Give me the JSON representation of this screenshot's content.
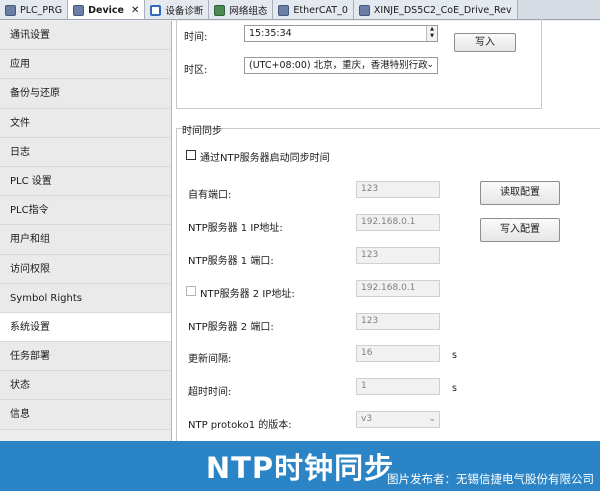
{
  "tabs": [
    {
      "label": "PLC_PRG",
      "icon": "document-icon"
    },
    {
      "label": "Device",
      "icon": "device-icon",
      "closable": true
    },
    {
      "label": "设备诊断",
      "icon": "search-icon"
    },
    {
      "label": "网络组态",
      "icon": "network-icon"
    },
    {
      "label": "EtherCAT_0",
      "icon": "document-icon"
    },
    {
      "label": "XINJE_DS5C2_CoE_Drive_Rev",
      "icon": "document-icon"
    }
  ],
  "tab_close": "✕",
  "sidebar": {
    "items": [
      {
        "label": "通讯设置"
      },
      {
        "label": "应用"
      },
      {
        "label": "备份与还原"
      },
      {
        "label": "文件"
      },
      {
        "label": "日志"
      },
      {
        "label": "PLC 设置"
      },
      {
        "label": "PLC指令"
      },
      {
        "label": "用户和组"
      },
      {
        "label": "访问权限"
      },
      {
        "label": "Symbol Rights"
      },
      {
        "label": "系统设置",
        "selected": true
      },
      {
        "label": "任务部署"
      },
      {
        "label": "状态"
      },
      {
        "label": "信息"
      }
    ]
  },
  "time_settings": {
    "time_label": "时间:",
    "time_value": "15:35:34",
    "timezone_label": "时区:",
    "timezone_value": "(UTC+08:00) 北京，重庆，香港特别行政",
    "write_button": "写入"
  },
  "time_sync": {
    "group_title": "时间同步",
    "enable_ntp_label": "通过NTP服务器启动同步时间",
    "own_port_label": "自有端口:",
    "own_port_value": "123",
    "ntp1_ip_label": "NTP服务器 1 IP地址:",
    "ntp1_ip_value": "192.168.0.1",
    "ntp1_port_label": "NTP服务器 1 端口:",
    "ntp1_port_value": "123",
    "ntp2_ip_label": "NTP服务器 2 IP地址:",
    "ntp2_ip_value": "192.168.0.1",
    "ntp2_port_label": "NTP服务器 2 端口:",
    "ntp2_port_value": "123",
    "update_interval_label": "更新间隔:",
    "update_interval_value": "16",
    "update_interval_unit": "s",
    "timeout_label": "超时时间:",
    "timeout_value": "1",
    "timeout_unit": "s",
    "protocol_label": "NTP protoko1 的版本:",
    "protocol_value": "v3",
    "read_config_button": "读取配置",
    "write_config_button": "写入配置"
  },
  "banner": {
    "title": "NTP时钟同步",
    "credit": "图片发布者：无锡信捷电气股份有限公司"
  }
}
